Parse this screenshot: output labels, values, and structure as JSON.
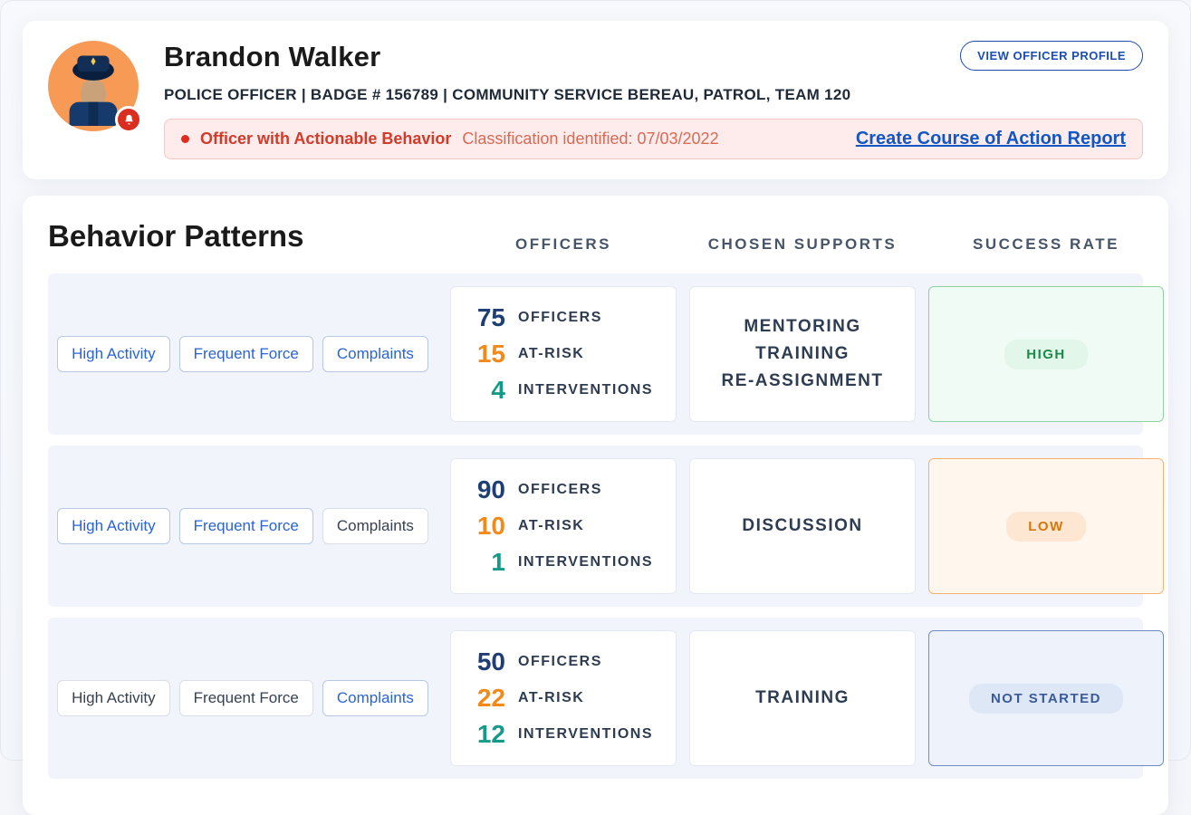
{
  "header": {
    "name": "Brandon Walker",
    "subtitle": "POLICE OFFICER | BADGE # 156789 | COMMUNITY SERVICE BEREAU, PATROL, TEAM 120",
    "view_profile": "VIEW OFFICER PROFILE",
    "alert_title": "Officer with Actionable Behavior",
    "alert_subtitle": "Classification identified: 07/03/2022",
    "alert_link": "Create Course of Action Report"
  },
  "patterns": {
    "title": "Behavior Patterns",
    "columns": {
      "officers": "OFFICERS",
      "supports": "CHOSEN SUPPORTS",
      "rate": "SUCCESS RATE"
    },
    "tag_labels": {
      "high_activity": "High Activity",
      "frequent_force": "Frequent Force",
      "complaints": "Complaints"
    },
    "stat_labels": {
      "officers": "OFFICERS",
      "at_risk": "AT-RISK",
      "interventions": "INTERVENTIONS"
    },
    "rows": [
      {
        "tags_active": {
          "high_activity": true,
          "frequent_force": true,
          "complaints": true
        },
        "stats": {
          "officers": "75",
          "at_risk": "15",
          "interventions": "4"
        },
        "supports": [
          "MENTORING",
          "TRAINING",
          "RE-ASSIGNMENT"
        ],
        "rate": {
          "class": "rate-high",
          "label": "HIGH"
        }
      },
      {
        "tags_active": {
          "high_activity": true,
          "frequent_force": true,
          "complaints": false
        },
        "stats": {
          "officers": "90",
          "at_risk": "10",
          "interventions": "1"
        },
        "supports": [
          "DISCUSSION"
        ],
        "rate": {
          "class": "rate-low",
          "label": "LOW"
        }
      },
      {
        "tags_active": {
          "high_activity": false,
          "frequent_force": false,
          "complaints": true
        },
        "stats": {
          "officers": "50",
          "at_risk": "22",
          "interventions": "12"
        },
        "supports": [
          "TRAINING"
        ],
        "rate": {
          "class": "rate-ns",
          "label": "NOT STARTED"
        }
      }
    ]
  }
}
